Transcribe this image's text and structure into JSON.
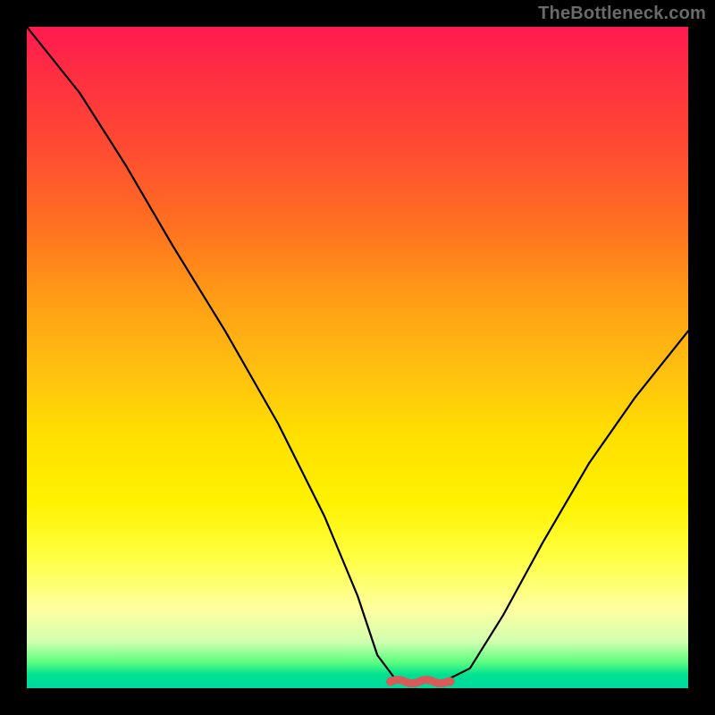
{
  "watermark_text": "TheBottleneck.com",
  "colors": {
    "frame": "#000000",
    "curve_stroke": "#000000",
    "valley_marker": "#d85a5a"
  },
  "chart_data": {
    "type": "line",
    "title": "",
    "xlabel": "",
    "ylabel": "",
    "xlim": [
      0,
      100
    ],
    "ylim": [
      0,
      100
    ],
    "series": [
      {
        "name": "bottleneck-curve",
        "x": [
          0,
          8,
          15,
          22,
          30,
          38,
          45,
          50,
          53,
          56,
          60,
          63,
          67,
          72,
          78,
          85,
          92,
          100
        ],
        "values": [
          100,
          90,
          79,
          67,
          54,
          40,
          26,
          14,
          5,
          1,
          1,
          1,
          3,
          11,
          22,
          34,
          44,
          54
        ]
      }
    ],
    "grid": false,
    "legend": false,
    "annotations": [
      {
        "name": "valley-flat-region",
        "x_range": [
          55,
          64
        ],
        "y": 1
      }
    ],
    "background_gradient": [
      {
        "stop": 0,
        "color": "#ff1a50"
      },
      {
        "stop": 50,
        "color": "#ffc010"
      },
      {
        "stop": 80,
        "color": "#ffff40"
      },
      {
        "stop": 100,
        "color": "#00d8a0"
      }
    ]
  }
}
